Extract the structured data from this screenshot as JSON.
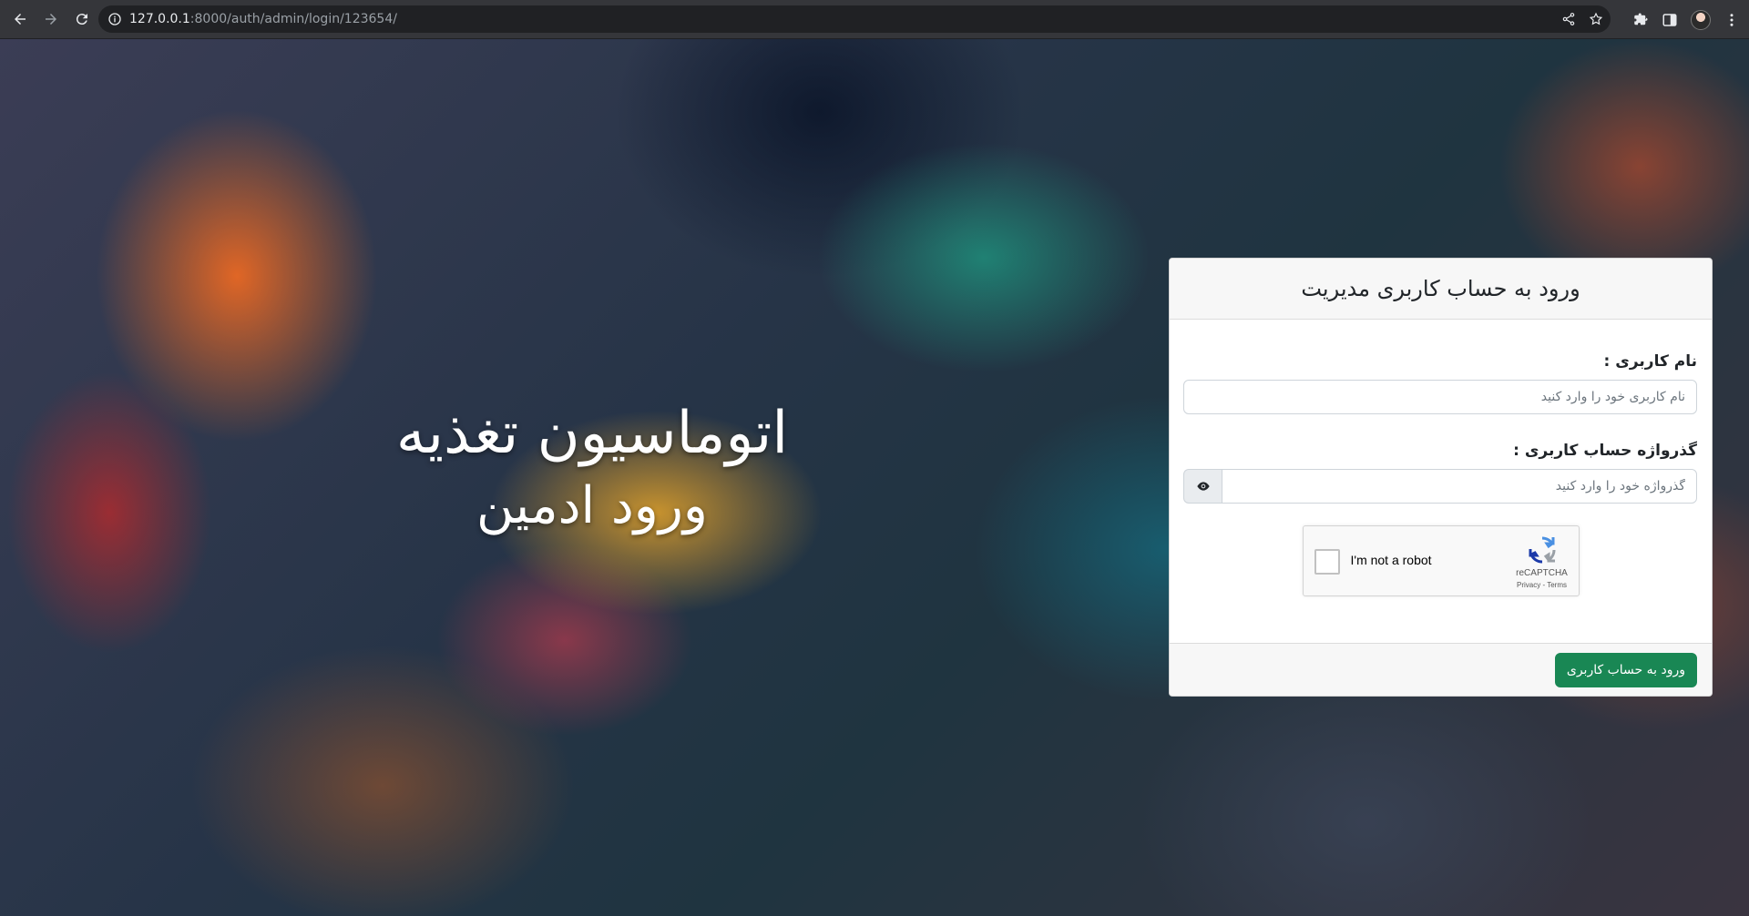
{
  "browser": {
    "url_host": "127.0.0.1",
    "url_path": ":8000/auth/admin/login/123654/"
  },
  "hero": {
    "title": "اتوماسیون تغذیه",
    "subtitle": "ورود ادمین"
  },
  "login_card": {
    "header": "ورود به حساب کاربری مدیریت",
    "username_label": "نام کاربری :",
    "username_placeholder": "نام کاربری خود را وارد کنید",
    "password_label": "گذرواژه حساب کاربری :",
    "password_placeholder": "گذرواژه خود را وارد کنید",
    "submit_label": "ورود به حساب کاربری"
  },
  "recaptcha": {
    "label": "I'm not a robot",
    "brand": "reCAPTCHA",
    "terms": "Privacy - Terms"
  },
  "colors": {
    "primary_button": "#198754",
    "chrome_bg": "#35363a"
  }
}
